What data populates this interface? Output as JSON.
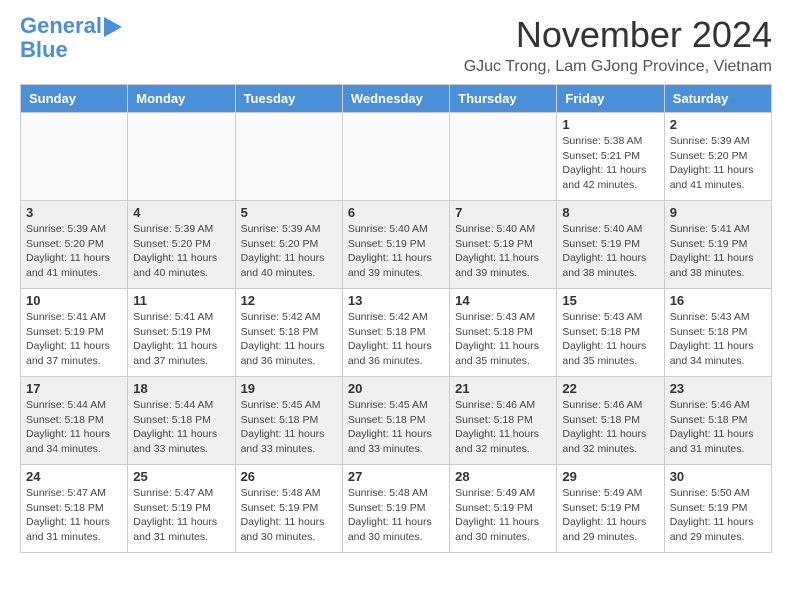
{
  "header": {
    "logo_line1": "General",
    "logo_line2": "Blue",
    "month_title": "November 2024",
    "location": "GJuc Trong, Lam GJong Province, Vietnam"
  },
  "weekdays": [
    "Sunday",
    "Monday",
    "Tuesday",
    "Wednesday",
    "Thursday",
    "Friday",
    "Saturday"
  ],
  "weeks": [
    [
      {
        "day": "",
        "info": ""
      },
      {
        "day": "",
        "info": ""
      },
      {
        "day": "",
        "info": ""
      },
      {
        "day": "",
        "info": ""
      },
      {
        "day": "",
        "info": ""
      },
      {
        "day": "1",
        "info": "Sunrise: 5:38 AM\nSunset: 5:21 PM\nDaylight: 11 hours and 42 minutes."
      },
      {
        "day": "2",
        "info": "Sunrise: 5:39 AM\nSunset: 5:20 PM\nDaylight: 11 hours and 41 minutes."
      }
    ],
    [
      {
        "day": "3",
        "info": "Sunrise: 5:39 AM\nSunset: 5:20 PM\nDaylight: 11 hours and 41 minutes."
      },
      {
        "day": "4",
        "info": "Sunrise: 5:39 AM\nSunset: 5:20 PM\nDaylight: 11 hours and 40 minutes."
      },
      {
        "day": "5",
        "info": "Sunrise: 5:39 AM\nSunset: 5:20 PM\nDaylight: 11 hours and 40 minutes."
      },
      {
        "day": "6",
        "info": "Sunrise: 5:40 AM\nSunset: 5:19 PM\nDaylight: 11 hours and 39 minutes."
      },
      {
        "day": "7",
        "info": "Sunrise: 5:40 AM\nSunset: 5:19 PM\nDaylight: 11 hours and 39 minutes."
      },
      {
        "day": "8",
        "info": "Sunrise: 5:40 AM\nSunset: 5:19 PM\nDaylight: 11 hours and 38 minutes."
      },
      {
        "day": "9",
        "info": "Sunrise: 5:41 AM\nSunset: 5:19 PM\nDaylight: 11 hours and 38 minutes."
      }
    ],
    [
      {
        "day": "10",
        "info": "Sunrise: 5:41 AM\nSunset: 5:19 PM\nDaylight: 11 hours and 37 minutes."
      },
      {
        "day": "11",
        "info": "Sunrise: 5:41 AM\nSunset: 5:19 PM\nDaylight: 11 hours and 37 minutes."
      },
      {
        "day": "12",
        "info": "Sunrise: 5:42 AM\nSunset: 5:18 PM\nDaylight: 11 hours and 36 minutes."
      },
      {
        "day": "13",
        "info": "Sunrise: 5:42 AM\nSunset: 5:18 PM\nDaylight: 11 hours and 36 minutes."
      },
      {
        "day": "14",
        "info": "Sunrise: 5:43 AM\nSunset: 5:18 PM\nDaylight: 11 hours and 35 minutes."
      },
      {
        "day": "15",
        "info": "Sunrise: 5:43 AM\nSunset: 5:18 PM\nDaylight: 11 hours and 35 minutes."
      },
      {
        "day": "16",
        "info": "Sunrise: 5:43 AM\nSunset: 5:18 PM\nDaylight: 11 hours and 34 minutes."
      }
    ],
    [
      {
        "day": "17",
        "info": "Sunrise: 5:44 AM\nSunset: 5:18 PM\nDaylight: 11 hours and 34 minutes."
      },
      {
        "day": "18",
        "info": "Sunrise: 5:44 AM\nSunset: 5:18 PM\nDaylight: 11 hours and 33 minutes."
      },
      {
        "day": "19",
        "info": "Sunrise: 5:45 AM\nSunset: 5:18 PM\nDaylight: 11 hours and 33 minutes."
      },
      {
        "day": "20",
        "info": "Sunrise: 5:45 AM\nSunset: 5:18 PM\nDaylight: 11 hours and 33 minutes."
      },
      {
        "day": "21",
        "info": "Sunrise: 5:46 AM\nSunset: 5:18 PM\nDaylight: 11 hours and 32 minutes."
      },
      {
        "day": "22",
        "info": "Sunrise: 5:46 AM\nSunset: 5:18 PM\nDaylight: 11 hours and 32 minutes."
      },
      {
        "day": "23",
        "info": "Sunrise: 5:46 AM\nSunset: 5:18 PM\nDaylight: 11 hours and 31 minutes."
      }
    ],
    [
      {
        "day": "24",
        "info": "Sunrise: 5:47 AM\nSunset: 5:18 PM\nDaylight: 11 hours and 31 minutes."
      },
      {
        "day": "25",
        "info": "Sunrise: 5:47 AM\nSunset: 5:19 PM\nDaylight: 11 hours and 31 minutes."
      },
      {
        "day": "26",
        "info": "Sunrise: 5:48 AM\nSunset: 5:19 PM\nDaylight: 11 hours and 30 minutes."
      },
      {
        "day": "27",
        "info": "Sunrise: 5:48 AM\nSunset: 5:19 PM\nDaylight: 11 hours and 30 minutes."
      },
      {
        "day": "28",
        "info": "Sunrise: 5:49 AM\nSunset: 5:19 PM\nDaylight: 11 hours and 30 minutes."
      },
      {
        "day": "29",
        "info": "Sunrise: 5:49 AM\nSunset: 5:19 PM\nDaylight: 11 hours and 29 minutes."
      },
      {
        "day": "30",
        "info": "Sunrise: 5:50 AM\nSunset: 5:19 PM\nDaylight: 11 hours and 29 minutes."
      }
    ]
  ]
}
